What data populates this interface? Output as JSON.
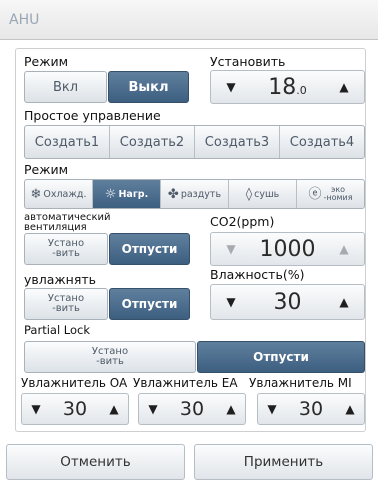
{
  "window": {
    "title": "AHU"
  },
  "mode": {
    "label": "Режим",
    "on_label": "Вкл",
    "off_label": "Выкл",
    "selected": "Выкл"
  },
  "setpoint": {
    "label": "Установить",
    "value": "18",
    "unit": ".0"
  },
  "simple_control": {
    "label": "Простое управление",
    "buttons": [
      "Создать1",
      "Создать2",
      "Создать3",
      "Создать4"
    ]
  },
  "op_mode": {
    "label": "Режим",
    "items": [
      {
        "icon": "snowflake-icon",
        "glyph": "❄",
        "label": "Охлажд."
      },
      {
        "icon": "sun-icon",
        "glyph": "☼",
        "label": "Нагр."
      },
      {
        "icon": "fan-icon",
        "glyph": "✤",
        "label": "раздуть"
      },
      {
        "icon": "drop-icon",
        "glyph": "◊",
        "label": "сушь"
      },
      {
        "icon": "eco-icon",
        "glyph": "ⓔ",
        "label_line1": "эко",
        "label_line2": "-номия"
      }
    ],
    "selected": "Нагр."
  },
  "auto_vent": {
    "label_line1": "автоматический",
    "label_line2": "вентиляция",
    "set_line1": "Устано",
    "set_line2": "-вить",
    "release_label": "Отпусти"
  },
  "co2": {
    "label": "CO2(ppm)",
    "value": "1000"
  },
  "humidify": {
    "label": "увлажнять",
    "set_line1": "Устано",
    "set_line2": "-вить",
    "release_label": "Отпусти"
  },
  "humidity": {
    "label": "Влажность(%)",
    "value": "30"
  },
  "partial_lock": {
    "label": "Partial Lock",
    "set_line1": "Устано",
    "set_line2": "-вить",
    "release_label": "Отпусти"
  },
  "humidifiers": [
    {
      "label": "Увлажнитель OA",
      "value": "30"
    },
    {
      "label": "Увлажнитель EA",
      "value": "30"
    },
    {
      "label": "Увлажнитель MI",
      "value": "30"
    }
  ],
  "footer": {
    "cancel_label": "Отменить",
    "apply_label": "Применить"
  },
  "colors": {
    "accent": "#4a6b8c",
    "disabled_arrow": "#a7abaf"
  }
}
